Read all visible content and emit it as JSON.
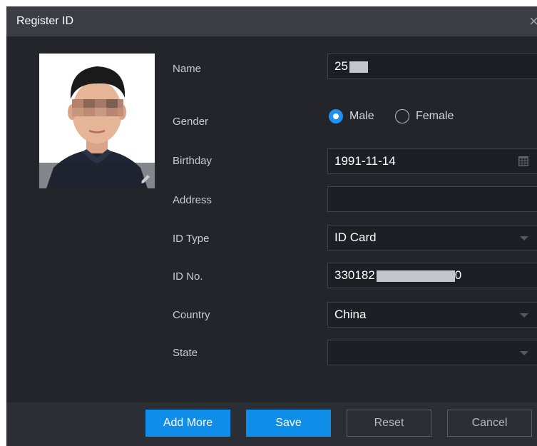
{
  "dialog": {
    "title": "Register ID",
    "close_glyph": "×"
  },
  "photo": {
    "icon": "edit-pencil-icon"
  },
  "form": {
    "name_label": "Name",
    "name_value": "25",
    "gender_label": "Gender",
    "gender_options": [
      "Male",
      "Female"
    ],
    "gender_selected": "Male",
    "birthday_label": "Birthday",
    "birthday_value": "1991-11-14",
    "address_label": "Address",
    "address_value": "",
    "id_type_label": "ID Type",
    "id_type_value": "ID Card",
    "id_no_label": "ID No.",
    "id_no_value_prefix": "330182",
    "id_no_value_suffix": "0",
    "country_label": "Country",
    "country_value": "China",
    "state_label": "State",
    "state_value": ""
  },
  "footer": {
    "add_more": "Add More",
    "save": "Save",
    "reset": "Reset",
    "cancel": "Cancel"
  },
  "colors": {
    "background": "#23252b",
    "titlebar": "#3a3d44",
    "accent": "#0f8ee9"
  }
}
